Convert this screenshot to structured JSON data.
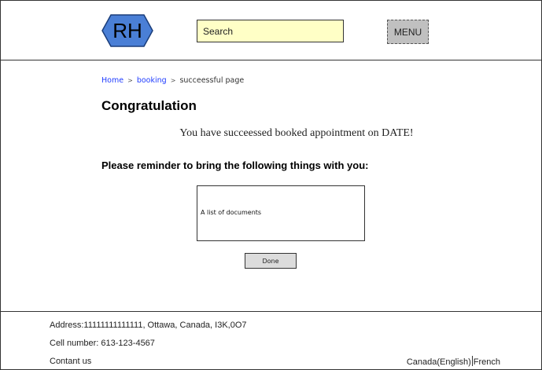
{
  "header": {
    "logo_text": "RH",
    "search_placeholder": "Search",
    "menu_label": "MENU"
  },
  "breadcrumb": {
    "home": "Home",
    "separator": ">",
    "booking": "booking",
    "current": "succeessful page"
  },
  "main": {
    "title": "Congratulation",
    "message": "You have succeessed booked appointment on DATE!",
    "reminder": "Please reminder to bring the following things with you:",
    "documents_text": "A list of documents",
    "done_label": "Done"
  },
  "footer": {
    "address": "Address:11111111111111, Ottawa, Canada, I3K,0O7",
    "cell": "Cell number: 613-123-4567",
    "contact": "Contant us",
    "lang_english": "Canada(English)",
    "lang_french": "French"
  },
  "colors": {
    "logo_fill": "#4a7fd6",
    "search_bg": "#ffffc6",
    "menu_bg": "#c0c0c0",
    "link": "#1f3cff"
  }
}
